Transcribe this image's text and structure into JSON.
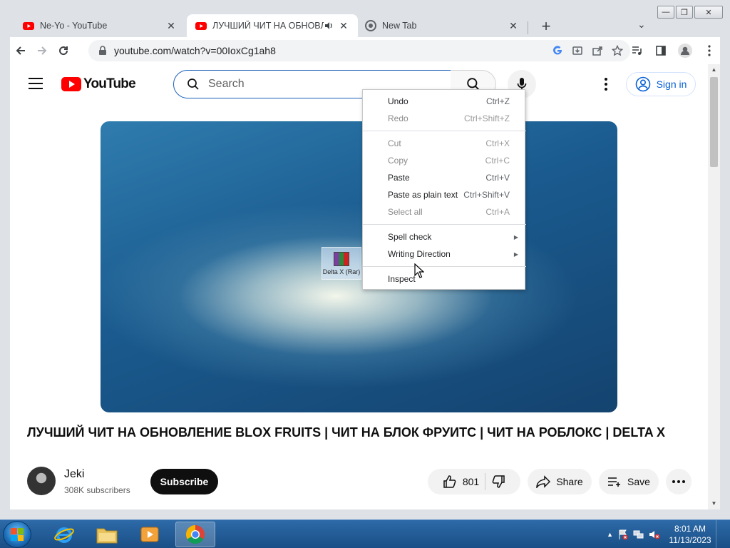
{
  "window": {
    "minimize": "—",
    "maximize": "❐",
    "close": "✕"
  },
  "tabs": [
    {
      "title": "Ne-Yo - YouTube",
      "active": false
    },
    {
      "title": "ЛУЧШИЙ ЧИТ НА ОБНОВЛ",
      "active": true
    },
    {
      "title": "New Tab",
      "active": false
    }
  ],
  "toolbar": {
    "url": "youtube.com/watch?v=00IoxCg1ah8"
  },
  "youtube": {
    "logo_text": "YouTube",
    "search_placeholder": "Search",
    "sign_in": "Sign in"
  },
  "video": {
    "title": "ЛУЧШИЙ ЧИТ НА ОБНОВЛЕНИЕ BLOX FRUITS | ЧИТ НА БЛОК ФРУИТС | ЧИТ НА РОБЛОКС | DELTA X",
    "desktop_icon_label": "Delta X (Rar)"
  },
  "channel": {
    "name": "Jeki",
    "subscribers": "308K subscribers",
    "subscribe_label": "Subscribe"
  },
  "actions": {
    "likes": "801",
    "share": "Share",
    "save": "Save"
  },
  "context_menu": {
    "undo": {
      "label": "Undo",
      "shortcut": "Ctrl+Z"
    },
    "redo": {
      "label": "Redo",
      "shortcut": "Ctrl+Shift+Z"
    },
    "cut": {
      "label": "Cut",
      "shortcut": "Ctrl+X"
    },
    "copy": {
      "label": "Copy",
      "shortcut": "Ctrl+C"
    },
    "paste": {
      "label": "Paste",
      "shortcut": "Ctrl+V"
    },
    "paste_plain": {
      "label": "Paste as plain text",
      "shortcut": "Ctrl+Shift+V"
    },
    "select_all": {
      "label": "Select all",
      "shortcut": "Ctrl+A"
    },
    "spell_check": {
      "label": "Spell check"
    },
    "writing_direction": {
      "label": "Writing Direction"
    },
    "inspect": {
      "label": "Inspect"
    }
  },
  "taskbar": {
    "time": "8:01 AM",
    "date": "11/13/2023"
  },
  "colors": {
    "youtube_red": "#ff0000",
    "link_blue": "#065fd4",
    "taskbar": "#1f5893"
  }
}
